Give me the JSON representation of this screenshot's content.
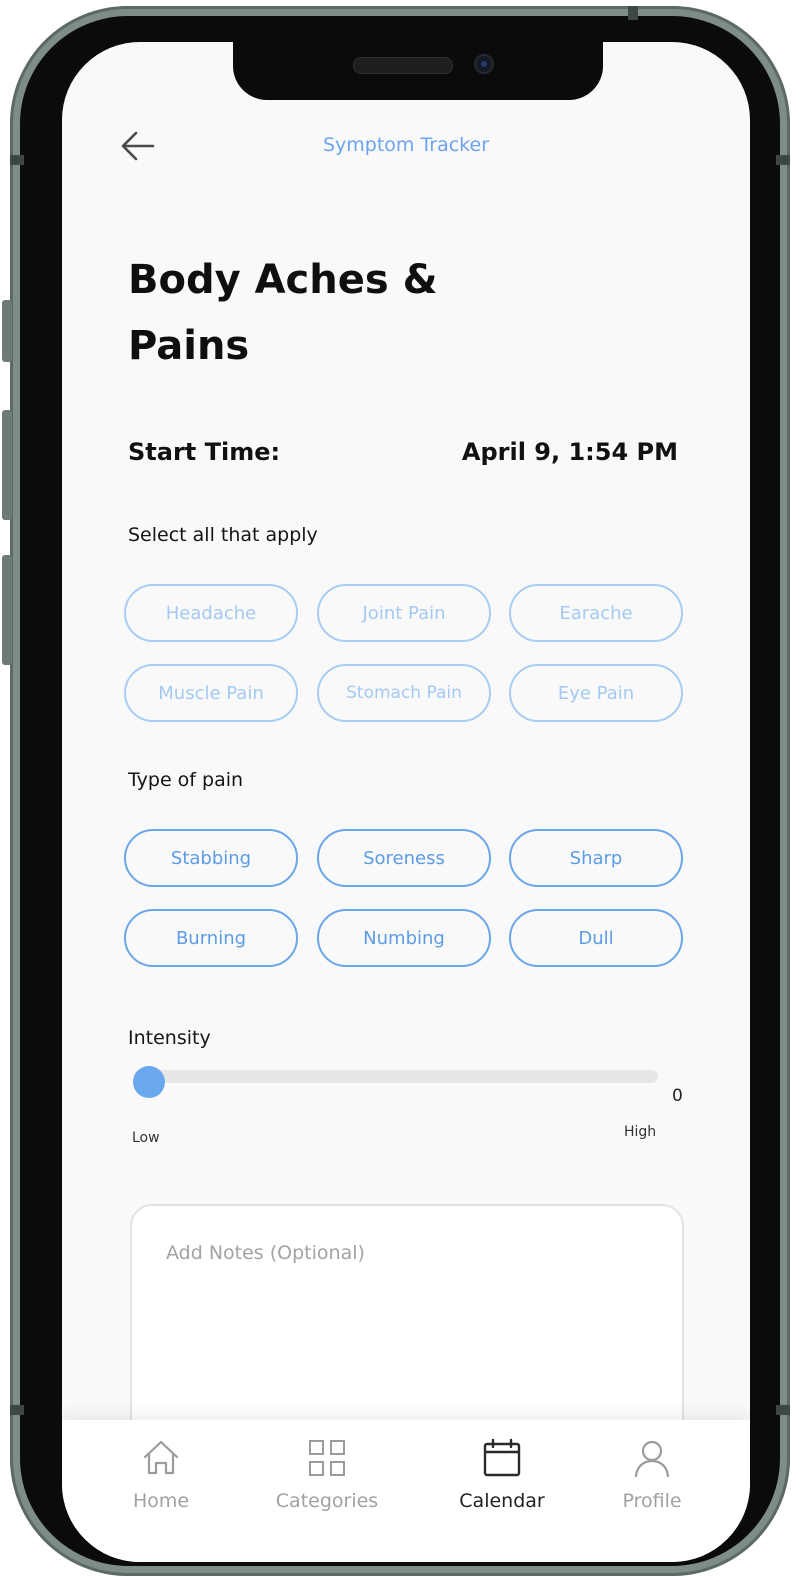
{
  "header": {
    "title": "Symptom Tracker",
    "back_icon": "arrow-left-icon"
  },
  "page": {
    "title": "Body Aches & Pains",
    "start_time_label": "Start Time:",
    "start_time_value": "April 9, 1:54 PM"
  },
  "pain_locations": {
    "label": "Select all that apply",
    "options": [
      "Headache",
      "Joint Pain",
      "Earache",
      "Muscle Pain",
      "Stomach Pain",
      "Eye Pain"
    ]
  },
  "pain_types": {
    "label": "Type of pain",
    "options": [
      "Stabbing",
      "Soreness",
      "Sharp",
      "Burning",
      "Numbing",
      "Dull"
    ]
  },
  "intensity": {
    "label": "Intensity",
    "value": "0",
    "min_label": "Low",
    "max_label": "High",
    "fraction": 0
  },
  "notes": {
    "placeholder": "Add Notes (Optional)"
  },
  "tabbar": {
    "items": [
      {
        "label": "Home",
        "icon": "home-icon"
      },
      {
        "label": "Categories",
        "icon": "grid-icon"
      },
      {
        "label": "Calendar",
        "icon": "calendar-icon",
        "active": true
      },
      {
        "label": "Profile",
        "icon": "user-icon"
      }
    ]
  },
  "colors": {
    "accent": "#6ea3ee",
    "chip_light_border": "#a7cdf4",
    "chip_strong_border": "#6aa7e8",
    "slider_thumb": "#69a8ee",
    "screen_bg": "#f9f9f9",
    "frame": "#7e8d86"
  }
}
